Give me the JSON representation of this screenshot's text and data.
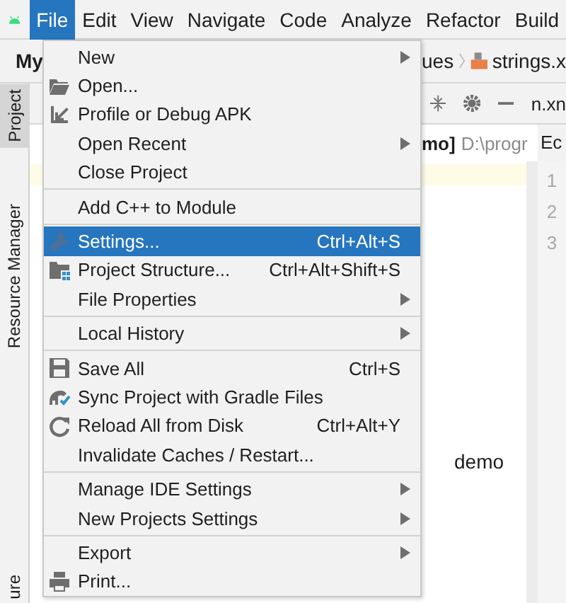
{
  "menu_bar": {
    "items": [
      {
        "label": "File",
        "selected": true
      },
      {
        "label": "Edit",
        "selected": false
      },
      {
        "label": "View",
        "selected": false
      },
      {
        "label": "Navigate",
        "selected": false
      },
      {
        "label": "Code",
        "selected": false
      },
      {
        "label": "Analyze",
        "selected": false
      },
      {
        "label": "Refactor",
        "selected": false
      },
      {
        "label": "Build",
        "selected": false
      }
    ]
  },
  "side_tabs": [
    {
      "label": "Project",
      "selected": true
    },
    {
      "label": "Resource Manager",
      "selected": false
    },
    {
      "label": "ure",
      "selected": false
    }
  ],
  "project_label": "My",
  "breadcrumb": {
    "folder": "ues",
    "file": "strings.x"
  },
  "editor_tab": "n.xn",
  "project_path": {
    "name": "mo]",
    "path": "D:\\progr"
  },
  "editor_header": "Ec",
  "line_numbers": [
    "1",
    "2",
    "3"
  ],
  "tree_text": "demo",
  "file_menu": {
    "groups": [
      [
        {
          "label": "New",
          "kind": "plain",
          "submenu": true,
          "selected": false
        },
        {
          "label": "Open...",
          "kind": "open",
          "submenu": false,
          "selected": false
        },
        {
          "label": "Profile or Debug APK",
          "kind": "profile",
          "submenu": false,
          "selected": false
        },
        {
          "label": "Open Recent",
          "kind": "plain",
          "submenu": true,
          "selected": false
        },
        {
          "label": "Close Project",
          "kind": "plain",
          "submenu": false,
          "selected": false
        }
      ],
      [
        {
          "label": "Add C++ to Module",
          "kind": "plain",
          "submenu": false,
          "selected": false
        }
      ],
      [
        {
          "label": "Settings...",
          "kind": "settings",
          "shortcut": "Ctrl+Alt+S",
          "submenu": false,
          "selected": true
        },
        {
          "label": "Project Structure...",
          "kind": "structure",
          "shortcut": "Ctrl+Alt+Shift+S",
          "submenu": false,
          "selected": false
        },
        {
          "label": "File Properties",
          "kind": "plain",
          "submenu": true,
          "selected": false
        }
      ],
      [
        {
          "label": "Local History",
          "kind": "plain",
          "submenu": true,
          "selected": false
        }
      ],
      [
        {
          "label": "Save All",
          "kind": "save",
          "shortcut": "Ctrl+S",
          "submenu": false,
          "selected": false
        },
        {
          "label": "Sync Project with Gradle Files",
          "kind": "sync",
          "submenu": false,
          "selected": false
        },
        {
          "label": "Reload All from Disk",
          "kind": "reload",
          "shortcut": "Ctrl+Alt+Y",
          "submenu": false,
          "selected": false
        },
        {
          "label": "Invalidate Caches / Restart...",
          "kind": "plain",
          "submenu": false,
          "selected": false
        }
      ],
      [
        {
          "label": "Manage IDE Settings",
          "kind": "plain",
          "submenu": true,
          "selected": false
        },
        {
          "label": "New Projects Settings",
          "kind": "plain",
          "submenu": true,
          "selected": false
        }
      ],
      [
        {
          "label": "Export",
          "kind": "plain",
          "submenu": true,
          "selected": false
        },
        {
          "label": "Print...",
          "kind": "print",
          "submenu": false,
          "selected": false
        }
      ]
    ]
  }
}
